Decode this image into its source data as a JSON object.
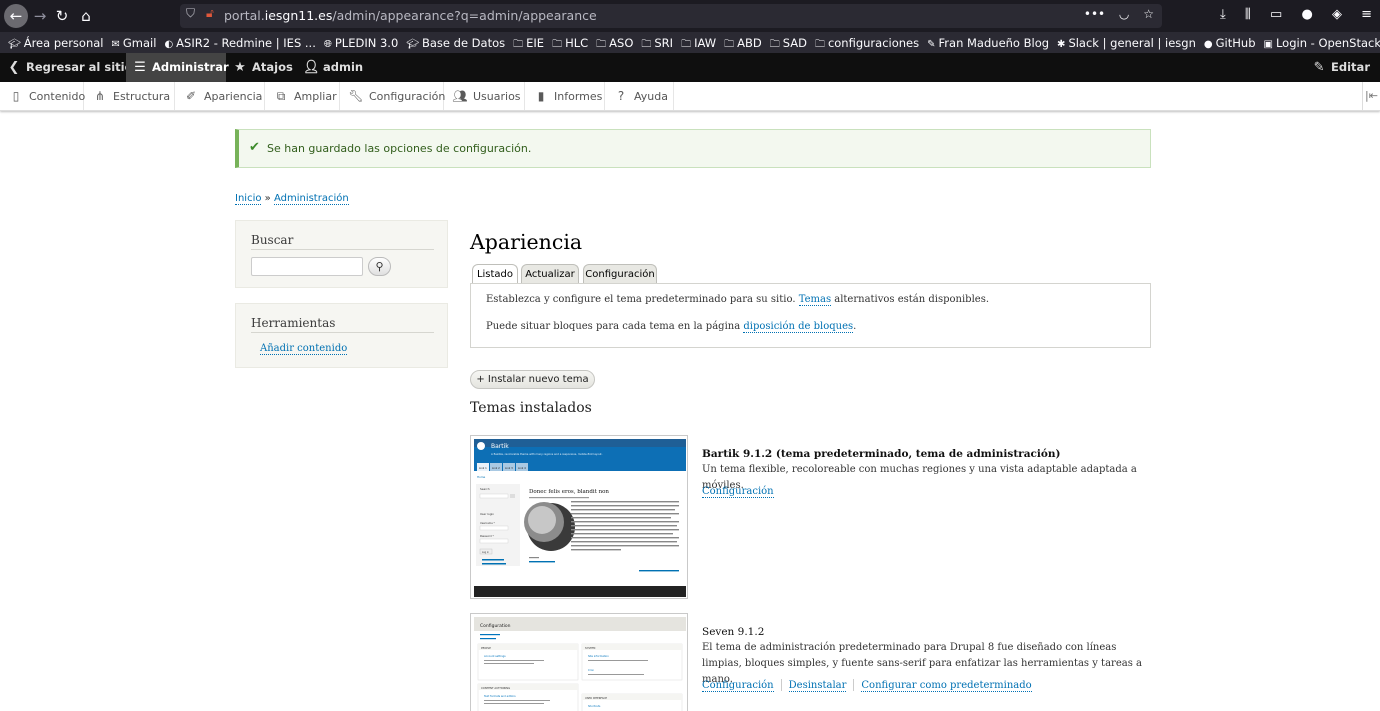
{
  "browser": {
    "url_prefix": "portal.",
    "url_domain": "iesgn11.es",
    "url_path": "/admin/appearance?q=admin/appearance"
  },
  "bookmarks": [
    {
      "label": "Área personal",
      "icon": "moodle-icon"
    },
    {
      "label": "Gmail",
      "icon": "gmail-icon"
    },
    {
      "label": "ASIR2 - Redmine | IES ...",
      "icon": "redmine-icon"
    },
    {
      "label": "PLEDIN 3.0",
      "icon": "globe-icon"
    },
    {
      "label": "Base de Datos",
      "icon": "moodle-icon"
    },
    {
      "label": "EIE",
      "icon": "folder-icon"
    },
    {
      "label": "HLC",
      "icon": "folder-icon"
    },
    {
      "label": "ASO",
      "icon": "folder-icon"
    },
    {
      "label": "SRI",
      "icon": "folder-icon"
    },
    {
      "label": "IAW",
      "icon": "folder-icon"
    },
    {
      "label": "ABD",
      "icon": "folder-icon"
    },
    {
      "label": "SAD",
      "icon": "folder-icon"
    },
    {
      "label": "configuraciones",
      "icon": "folder-icon"
    },
    {
      "label": "Fran Madueño Blog",
      "icon": "blog-icon"
    },
    {
      "label": "Slack | general | iesgn",
      "icon": "slack-icon"
    },
    {
      "label": "GitHub",
      "icon": "github-icon"
    },
    {
      "label": "Login - OpenStack Das...",
      "icon": "openstack-icon"
    }
  ],
  "toolbar": {
    "back": "Regresar al sitio",
    "admin": "Administrar",
    "shortcuts": "Atajos",
    "user": "admin",
    "edit": "Editar"
  },
  "tray": {
    "content": "Contenido",
    "structure": "Estructura",
    "appearance": "Apariencia",
    "extend": "Ampliar",
    "config": "Configuración",
    "people": "Usuarios",
    "reports": "Informes",
    "help": "Ayuda"
  },
  "message": "Se han guardado las opciones de configuración.",
  "breadcrumb": {
    "home": "Inicio",
    "sep": " » ",
    "admin": "Administración"
  },
  "sidebar": {
    "search_title": "Buscar",
    "tools_title": "Herramientas",
    "add_content": "Añadir contenido"
  },
  "page": {
    "title": "Apariencia",
    "tabs": [
      "Listado",
      "Actualizar",
      "Configuración"
    ],
    "help1_before": "Establezca y configure el tema predeterminado para su sitio. ",
    "help1_link": "Temas",
    "help1_after": " alternativos están disponibles.",
    "help2_before": "Puede situar bloques para cada tema en la página ",
    "help2_link": "diposición de bloques",
    "help2_after": ".",
    "install_button": "+ Instalar nuevo tema",
    "installed_title": "Temas instalados"
  },
  "themes": [
    {
      "name": "Bartik 9.1.2 (tema predeterminado, tema de administración)",
      "description": "Un tema flexible, recoloreable con muchas regiones y una vista adaptable adaptada a móviles.",
      "links": [
        "Configuración"
      ],
      "preview": {
        "site_name": "Bartik",
        "slogan": "A flexible, recolorable theme with many regions and a responsive, mobile-first layout.",
        "tabs": [
          "Link 1",
          "Link 2",
          "Link 3",
          "Link 4"
        ],
        "home": "Home",
        "article_title": "Donec felis eros, blandit non",
        "search": "Search",
        "login": "User login",
        "username": "Username *",
        "password": "Password *",
        "submit": "Log in"
      }
    },
    {
      "name": "Seven 9.1.2",
      "description": "El tema de administración predeterminado para Drupal 8 fue diseñado con líneas limpias, bloques simples, y fuente sans-serif para enfatizar las herramientas y tareas a mano.",
      "links": [
        "Configuración",
        "Desinstalar",
        "Configurar como predeterminado"
      ],
      "preview": {
        "title": "Configuration",
        "people": "PEOPLE",
        "system": "SYSTEM",
        "account": "Account settings",
        "site_info": "Site information",
        "cron": "Cron",
        "authoring": "CONTENT AUTHORING",
        "text_formats": "Text formats and editors",
        "ui": "USER INTERFACE",
        "shortcuts": "Shortcuts"
      }
    }
  ]
}
